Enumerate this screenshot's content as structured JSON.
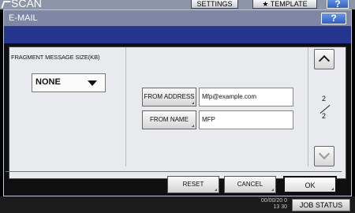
{
  "background": {
    "title": "SCAN",
    "settings_label": "SETTINGS",
    "template_label": "TEMPLATE",
    "template_icon": "star-icon",
    "help_label": "?"
  },
  "dialog": {
    "title": "E-MAIL",
    "help_label": "?"
  },
  "fragment": {
    "label": "FRAGMENT MESSAGE SIZE(KB)",
    "selected": "NONE"
  },
  "fields": {
    "from_address_label": "FROM ADDRESS",
    "from_address_value": "Mfp@example.com",
    "from_name_label": "FROM NAME",
    "from_name_value": "MFP"
  },
  "pagination": {
    "current": "2",
    "total": "2"
  },
  "footer": {
    "reset_label": "RESET",
    "cancel_label": "CANCEL",
    "ok_label": "OK"
  },
  "status_bar": {
    "date_line": "00/00/20 0",
    "time": "13 30",
    "job_status_label": "JOB STATUS"
  }
}
